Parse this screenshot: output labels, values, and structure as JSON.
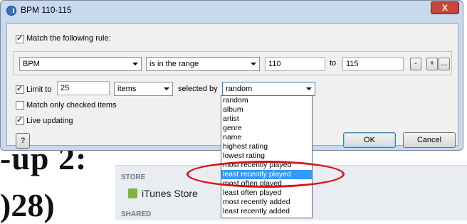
{
  "background": {
    "text_line1": "-up 2:",
    "text_line2": ")28)",
    "sidebar": {
      "store_header": "STORE",
      "itunes_store": "iTunes Store",
      "shared_header": "SHARED"
    }
  },
  "dialog": {
    "title": "BPM 110-115",
    "close_label": "X",
    "match_rule_label": "Match the following rule:",
    "rule": {
      "field": "BPM",
      "condition": "is in the range",
      "from": "110",
      "to_label": "to",
      "to": "115",
      "remove_label": "-",
      "add_label": "+",
      "more_label": "..."
    },
    "limit": {
      "label": "Limit to",
      "value": "25",
      "unit": "items",
      "selected_by_label": "selected by",
      "selected_by": "random"
    },
    "match_checked_label": "Match only checked items",
    "live_updating_label": "Live updating",
    "help_label": "?",
    "ok_label": "OK",
    "cancel_label": "Cancel"
  },
  "dropdown": {
    "options": [
      "random",
      "album",
      "artist",
      "genre",
      "name",
      "highest rating",
      "lowest rating",
      "most recently played",
      "least recently played",
      "most often played",
      "least often played",
      "most recently added",
      "least recently added"
    ],
    "selected_option": "least recently played"
  },
  "colors": {
    "highlight": "#3399ff",
    "annotation": "#d4141b"
  }
}
